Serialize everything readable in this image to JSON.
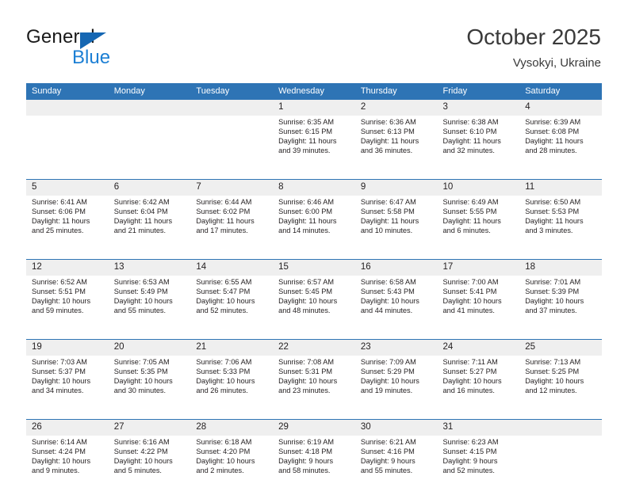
{
  "brand": {
    "name_part1": "General",
    "name_part2": "Blue",
    "accent_color": "#1567b3",
    "blue_text_color": "#1c7fd4"
  },
  "header": {
    "title": "October 2025",
    "location": "Vysokyi, Ukraine"
  },
  "calendar": {
    "header_bg": "#2e74b5",
    "daynum_bg": "#efefef",
    "weekdays": [
      "Sunday",
      "Monday",
      "Tuesday",
      "Wednesday",
      "Thursday",
      "Friday",
      "Saturday"
    ],
    "weeks": [
      [
        {
          "day": "",
          "sunrise": "",
          "sunset": "",
          "daylight_line1": "",
          "daylight_line2": ""
        },
        {
          "day": "",
          "sunrise": "",
          "sunset": "",
          "daylight_line1": "",
          "daylight_line2": ""
        },
        {
          "day": "",
          "sunrise": "",
          "sunset": "",
          "daylight_line1": "",
          "daylight_line2": ""
        },
        {
          "day": "1",
          "sunrise": "Sunrise: 6:35 AM",
          "sunset": "Sunset: 6:15 PM",
          "daylight_line1": "Daylight: 11 hours",
          "daylight_line2": "and 39 minutes."
        },
        {
          "day": "2",
          "sunrise": "Sunrise: 6:36 AM",
          "sunset": "Sunset: 6:13 PM",
          "daylight_line1": "Daylight: 11 hours",
          "daylight_line2": "and 36 minutes."
        },
        {
          "day": "3",
          "sunrise": "Sunrise: 6:38 AM",
          "sunset": "Sunset: 6:10 PM",
          "daylight_line1": "Daylight: 11 hours",
          "daylight_line2": "and 32 minutes."
        },
        {
          "day": "4",
          "sunrise": "Sunrise: 6:39 AM",
          "sunset": "Sunset: 6:08 PM",
          "daylight_line1": "Daylight: 11 hours",
          "daylight_line2": "and 28 minutes."
        }
      ],
      [
        {
          "day": "5",
          "sunrise": "Sunrise: 6:41 AM",
          "sunset": "Sunset: 6:06 PM",
          "daylight_line1": "Daylight: 11 hours",
          "daylight_line2": "and 25 minutes."
        },
        {
          "day": "6",
          "sunrise": "Sunrise: 6:42 AM",
          "sunset": "Sunset: 6:04 PM",
          "daylight_line1": "Daylight: 11 hours",
          "daylight_line2": "and 21 minutes."
        },
        {
          "day": "7",
          "sunrise": "Sunrise: 6:44 AM",
          "sunset": "Sunset: 6:02 PM",
          "daylight_line1": "Daylight: 11 hours",
          "daylight_line2": "and 17 minutes."
        },
        {
          "day": "8",
          "sunrise": "Sunrise: 6:46 AM",
          "sunset": "Sunset: 6:00 PM",
          "daylight_line1": "Daylight: 11 hours",
          "daylight_line2": "and 14 minutes."
        },
        {
          "day": "9",
          "sunrise": "Sunrise: 6:47 AM",
          "sunset": "Sunset: 5:58 PM",
          "daylight_line1": "Daylight: 11 hours",
          "daylight_line2": "and 10 minutes."
        },
        {
          "day": "10",
          "sunrise": "Sunrise: 6:49 AM",
          "sunset": "Sunset: 5:55 PM",
          "daylight_line1": "Daylight: 11 hours",
          "daylight_line2": "and 6 minutes."
        },
        {
          "day": "11",
          "sunrise": "Sunrise: 6:50 AM",
          "sunset": "Sunset: 5:53 PM",
          "daylight_line1": "Daylight: 11 hours",
          "daylight_line2": "and 3 minutes."
        }
      ],
      [
        {
          "day": "12",
          "sunrise": "Sunrise: 6:52 AM",
          "sunset": "Sunset: 5:51 PM",
          "daylight_line1": "Daylight: 10 hours",
          "daylight_line2": "and 59 minutes."
        },
        {
          "day": "13",
          "sunrise": "Sunrise: 6:53 AM",
          "sunset": "Sunset: 5:49 PM",
          "daylight_line1": "Daylight: 10 hours",
          "daylight_line2": "and 55 minutes."
        },
        {
          "day": "14",
          "sunrise": "Sunrise: 6:55 AM",
          "sunset": "Sunset: 5:47 PM",
          "daylight_line1": "Daylight: 10 hours",
          "daylight_line2": "and 52 minutes."
        },
        {
          "day": "15",
          "sunrise": "Sunrise: 6:57 AM",
          "sunset": "Sunset: 5:45 PM",
          "daylight_line1": "Daylight: 10 hours",
          "daylight_line2": "and 48 minutes."
        },
        {
          "day": "16",
          "sunrise": "Sunrise: 6:58 AM",
          "sunset": "Sunset: 5:43 PM",
          "daylight_line1": "Daylight: 10 hours",
          "daylight_line2": "and 44 minutes."
        },
        {
          "day": "17",
          "sunrise": "Sunrise: 7:00 AM",
          "sunset": "Sunset: 5:41 PM",
          "daylight_line1": "Daylight: 10 hours",
          "daylight_line2": "and 41 minutes."
        },
        {
          "day": "18",
          "sunrise": "Sunrise: 7:01 AM",
          "sunset": "Sunset: 5:39 PM",
          "daylight_line1": "Daylight: 10 hours",
          "daylight_line2": "and 37 minutes."
        }
      ],
      [
        {
          "day": "19",
          "sunrise": "Sunrise: 7:03 AM",
          "sunset": "Sunset: 5:37 PM",
          "daylight_line1": "Daylight: 10 hours",
          "daylight_line2": "and 34 minutes."
        },
        {
          "day": "20",
          "sunrise": "Sunrise: 7:05 AM",
          "sunset": "Sunset: 5:35 PM",
          "daylight_line1": "Daylight: 10 hours",
          "daylight_line2": "and 30 minutes."
        },
        {
          "day": "21",
          "sunrise": "Sunrise: 7:06 AM",
          "sunset": "Sunset: 5:33 PM",
          "daylight_line1": "Daylight: 10 hours",
          "daylight_line2": "and 26 minutes."
        },
        {
          "day": "22",
          "sunrise": "Sunrise: 7:08 AM",
          "sunset": "Sunset: 5:31 PM",
          "daylight_line1": "Daylight: 10 hours",
          "daylight_line2": "and 23 minutes."
        },
        {
          "day": "23",
          "sunrise": "Sunrise: 7:09 AM",
          "sunset": "Sunset: 5:29 PM",
          "daylight_line1": "Daylight: 10 hours",
          "daylight_line2": "and 19 minutes."
        },
        {
          "day": "24",
          "sunrise": "Sunrise: 7:11 AM",
          "sunset": "Sunset: 5:27 PM",
          "daylight_line1": "Daylight: 10 hours",
          "daylight_line2": "and 16 minutes."
        },
        {
          "day": "25",
          "sunrise": "Sunrise: 7:13 AM",
          "sunset": "Sunset: 5:25 PM",
          "daylight_line1": "Daylight: 10 hours",
          "daylight_line2": "and 12 minutes."
        }
      ],
      [
        {
          "day": "26",
          "sunrise": "Sunrise: 6:14 AM",
          "sunset": "Sunset: 4:24 PM",
          "daylight_line1": "Daylight: 10 hours",
          "daylight_line2": "and 9 minutes."
        },
        {
          "day": "27",
          "sunrise": "Sunrise: 6:16 AM",
          "sunset": "Sunset: 4:22 PM",
          "daylight_line1": "Daylight: 10 hours",
          "daylight_line2": "and 5 minutes."
        },
        {
          "day": "28",
          "sunrise": "Sunrise: 6:18 AM",
          "sunset": "Sunset: 4:20 PM",
          "daylight_line1": "Daylight: 10 hours",
          "daylight_line2": "and 2 minutes."
        },
        {
          "day": "29",
          "sunrise": "Sunrise: 6:19 AM",
          "sunset": "Sunset: 4:18 PM",
          "daylight_line1": "Daylight: 9 hours",
          "daylight_line2": "and 58 minutes."
        },
        {
          "day": "30",
          "sunrise": "Sunrise: 6:21 AM",
          "sunset": "Sunset: 4:16 PM",
          "daylight_line1": "Daylight: 9 hours",
          "daylight_line2": "and 55 minutes."
        },
        {
          "day": "31",
          "sunrise": "Sunrise: 6:23 AM",
          "sunset": "Sunset: 4:15 PM",
          "daylight_line1": "Daylight: 9 hours",
          "daylight_line2": "and 52 minutes."
        },
        {
          "day": "",
          "sunrise": "",
          "sunset": "",
          "daylight_line1": "",
          "daylight_line2": ""
        }
      ]
    ]
  }
}
